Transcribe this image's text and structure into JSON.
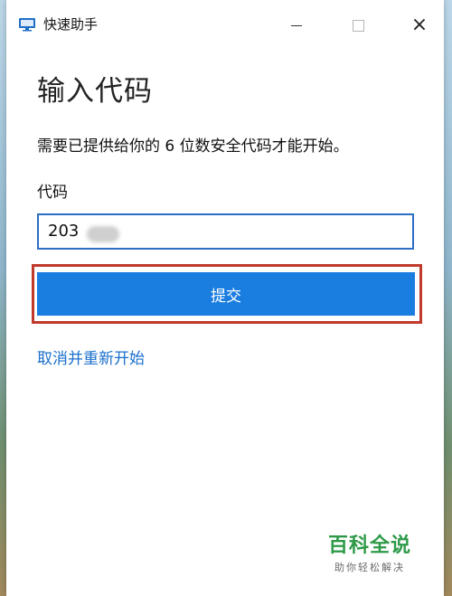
{
  "window": {
    "app_title": "快速助手",
    "icon": "quick-assist-monitor-icon",
    "controls": {
      "minimize": "minimize-icon",
      "maximize": "maximize-icon",
      "close": "×"
    }
  },
  "main": {
    "title": "输入代码",
    "instruction": "需要已提供给你的 6 位数安全代码才能开始。",
    "code_label": "代码",
    "code_value": "203",
    "submit_label": "提交",
    "cancel_label": "取消并重新开始"
  },
  "watermark": {
    "title": "百科全说",
    "subtitle": "助你轻松解决"
  },
  "colors": {
    "accent": "#1a7de0",
    "link": "#1a6fcc",
    "highlight": "#c0392b",
    "watermark": "#2e9a48"
  }
}
